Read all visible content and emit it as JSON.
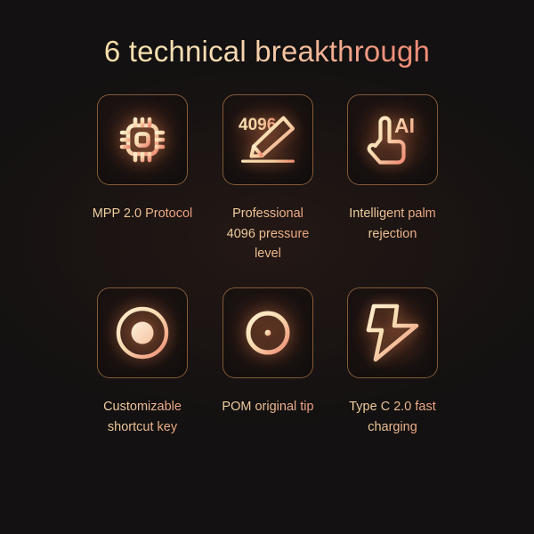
{
  "page": {
    "background_color": "#131111",
    "title": "6 technical breakthrough"
  },
  "theme": {
    "gradient_start": "#f6d79a",
    "gradient_mid": "#f3b99a",
    "gradient_end": "#ef8a74",
    "tile_border": "#c4864c",
    "tile_background": "#1b1414"
  },
  "features": [
    {
      "icon": "cpu-chip-icon",
      "caption_lines": [
        "MPP 2.0 Protocol"
      ]
    },
    {
      "icon": "stylus-pressure-4096-icon",
      "icon_label": "4096",
      "caption_lines": [
        "Professional",
        "4096 pressure",
        "level"
      ]
    },
    {
      "icon": "palm-rejection-ai-hand-icon",
      "icon_label": "AI",
      "caption_lines": [
        "Intelligent palm",
        "rejection"
      ]
    },
    {
      "icon": "shortcut-button-ring-icon",
      "caption_lines": [
        "Customizable",
        "shortcut key"
      ]
    },
    {
      "icon": "crosshair-tip-icon",
      "caption_lines": [
        "POM original tip"
      ]
    },
    {
      "icon": "lightning-bolt-fast-charge-icon",
      "caption_lines": [
        "Type C 2.0 fast",
        "charging"
      ]
    }
  ]
}
